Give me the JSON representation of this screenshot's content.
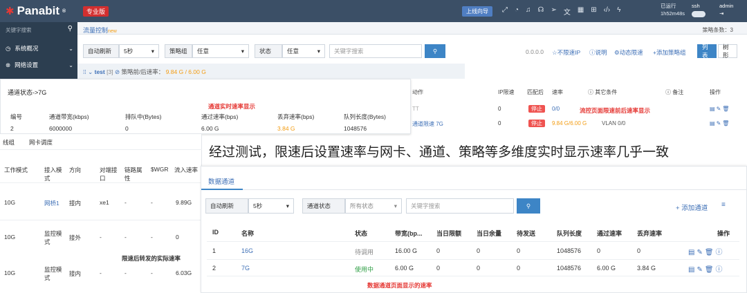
{
  "topbar": {
    "logo": "Panabit",
    "logo_mark": "®",
    "edition": "专业版",
    "guide_button": "上线向导",
    "uptime_label": "已运行",
    "uptime_value": "1h52m48s",
    "ssh_label": "ssh",
    "admin_label": "admin"
  },
  "sidebar": {
    "search_placeholder": "关键字搜索",
    "items": [
      {
        "label": "系统概况"
      },
      {
        "label": "网络设置"
      }
    ]
  },
  "tabbar": {
    "tab": "流量控制",
    "hot": "new",
    "policy_count": "策略条数：3"
  },
  "filter": {
    "refresh_label": "自动刷新",
    "refresh_value": "5秒",
    "group_label": "策略组",
    "group_value": "任意",
    "status_label": "状态",
    "status_value": "任意",
    "search_placeholder": "关键字搜索",
    "ip": "0.0.0.0",
    "unlimited_ip": "不限速IP",
    "help": "说明",
    "dynamic_limit": "动态限速",
    "add_group": "添加策略组",
    "view_list": "列表",
    "view_tree": "树形"
  },
  "test_row": {
    "name": "test",
    "count": "[3]",
    "label": "策略前/后速率：",
    "value": "9.84 G / 6.00 G"
  },
  "policy_table": {
    "headers": [
      "动作",
      "IP限速",
      "匹配后",
      "速率",
      "其它条件",
      "备注",
      "操作"
    ],
    "rows": [
      {
        "action": "TT",
        "ip_limit": "0",
        "badge": "停止",
        "rate": "0/0",
        "cond": ""
      },
      {
        "action": "通道限速 7G",
        "ip_limit": "0",
        "badge": "停止",
        "rate": "9.84 G/6.00 G",
        "cond": "VLAN 0/0"
      }
    ],
    "annotation": "流控页面限速前后速率显示"
  },
  "channel_panel": {
    "title": "通道状态->7G",
    "annotation": "通道实时速率显示",
    "headers": [
      "编号",
      "通道带宽(kbps)",
      "排队中(Bytes)",
      "通过速率(bps)",
      "丢弃速率(bps)",
      "队列长度(Bytes)"
    ],
    "row": [
      "2",
      "6000000",
      "0",
      "6.00 G",
      "3.84 G",
      "1048576"
    ]
  },
  "nic_panel": {
    "tabs": [
      "线组",
      "网卡调度"
    ],
    "headers": [
      "工作模式",
      "接入模式",
      "方向",
      "对端接口",
      "链路属性",
      "$WGR",
      "流入速率"
    ],
    "rows": [
      [
        "10G",
        "网桥1",
        "接内",
        "xe1",
        "-",
        "-",
        "9.89G"
      ],
      [
        "10G",
        "监控模式",
        "接外",
        "-",
        "-",
        "-",
        "0"
      ],
      [
        "10G",
        "监控模式",
        "接内",
        "-",
        "-",
        "-",
        "6.03G"
      ]
    ],
    "annotation": "限速后转发的实际速率"
  },
  "headline": "经过测试，限速后设置速率与网卡、通道、策略等多维度实时显示速率几乎一致",
  "data_channel": {
    "tab": "数据通道",
    "refresh_label": "自动刷新",
    "refresh_value": "5秒",
    "status_label": "通道状态",
    "status_value": "所有状态",
    "search_placeholder": "关键字搜索",
    "add_channel": "添加通道",
    "headers": [
      "ID",
      "名称",
      "状态",
      "带宽(bp...",
      "当日限额",
      "当日余量",
      "待发送",
      "队列长度",
      "通过速率",
      "丢弃速率",
      "操作"
    ],
    "rows": [
      {
        "id": "1",
        "name": "16G",
        "status": "待调用",
        "bw": "16.00 G",
        "limit": "0",
        "remain": "0",
        "pending": "0",
        "queue": "1048576",
        "pass": "0",
        "drop": "0"
      },
      {
        "id": "2",
        "name": "7G",
        "status": "使用中",
        "bw": "6.00 G",
        "limit": "0",
        "remain": "0",
        "pending": "0",
        "queue": "1048576",
        "pass": "6.00 G",
        "drop": "3.84 G"
      }
    ],
    "annotation": "数据通道页面显示的速率"
  },
  "colors": {
    "accent": "#3d85c6",
    "alert": "#e53935",
    "orange": "#f39c12",
    "green": "#2e9e44",
    "topbar": "#3b4f66"
  }
}
